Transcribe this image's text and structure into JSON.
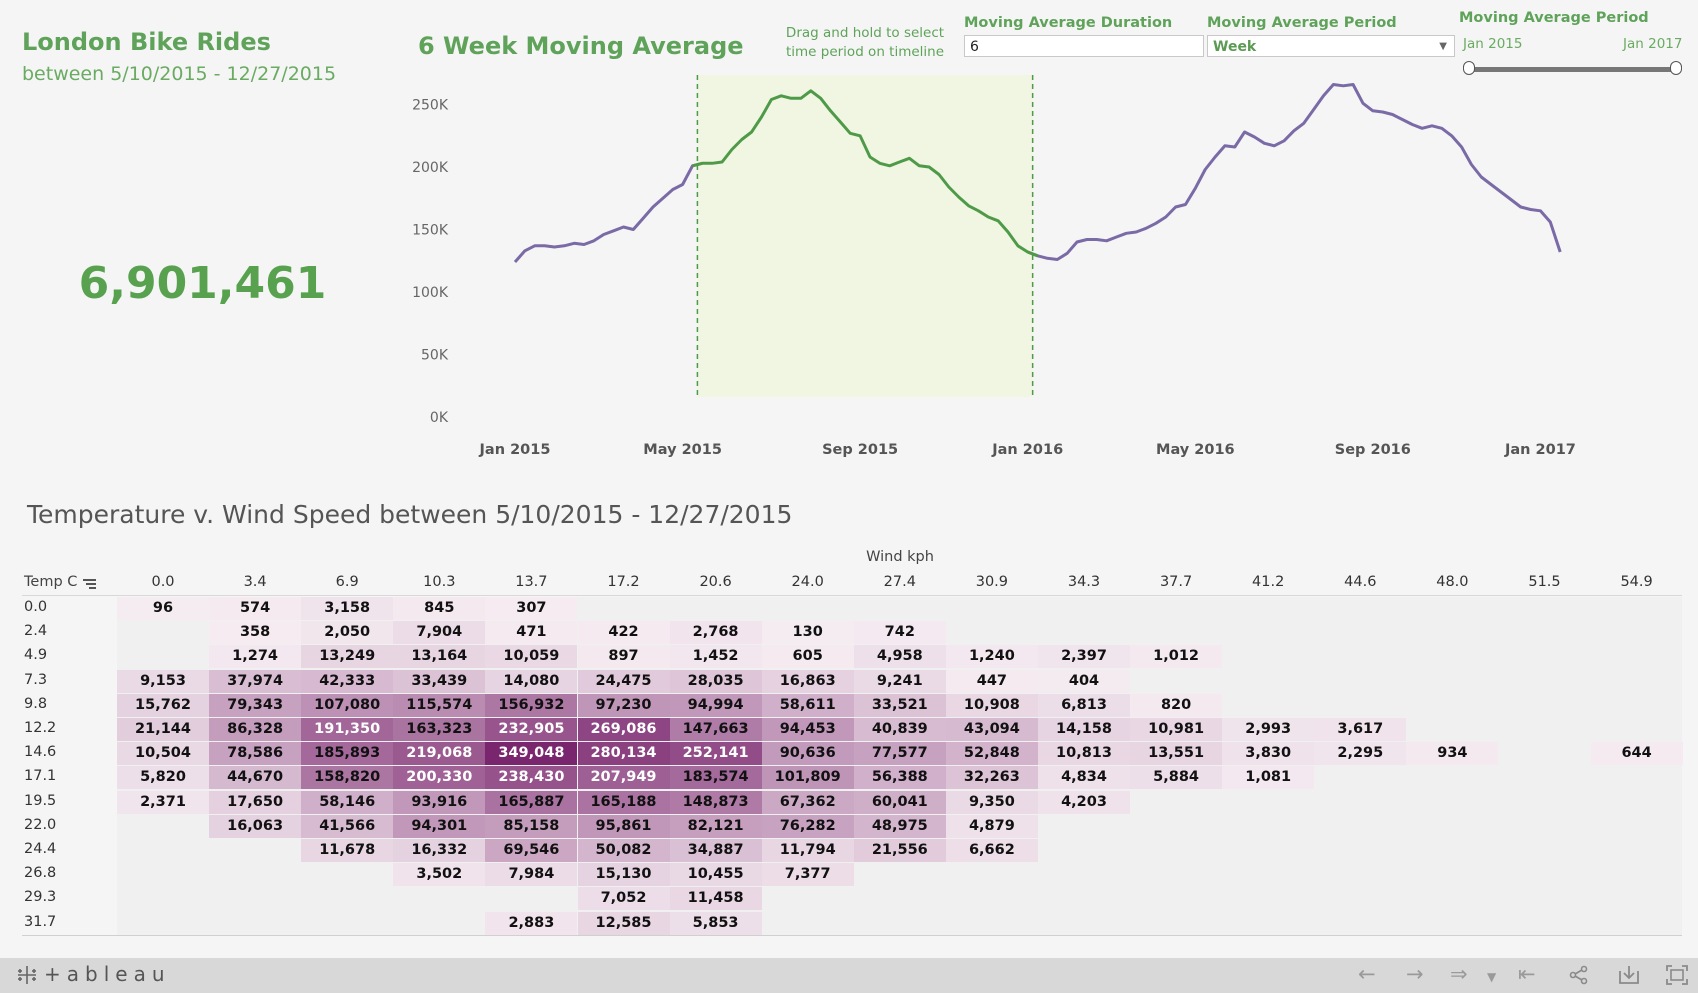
{
  "header": {
    "title": "London Bike Rides",
    "subtitle": "between 5/10/2015 - 12/27/2015",
    "kpi_total": "6,901,461"
  },
  "line_chart": {
    "title": "6 Week Moving Average",
    "hint": "Drag and hold to select time period on timeline"
  },
  "controls": {
    "duration_label": "Moving Average Duration",
    "duration_value": "6",
    "period_label": "Moving Average Period",
    "period_value": "Week",
    "slider_label": "Moving Average Period",
    "slider_min": "Jan 2015",
    "slider_max": "Jan 2017"
  },
  "heatmap": {
    "title": "Temperature v. Wind Speed between 5/10/2015 - 12/27/2015",
    "x_title": "Wind kph",
    "y_title": "Temp C",
    "columns": [
      "0.0",
      "3.4",
      "6.9",
      "10.3",
      "13.7",
      "17.2",
      "20.6",
      "24.0",
      "27.4",
      "30.9",
      "34.3",
      "37.7",
      "41.2",
      "44.6",
      "48.0",
      "51.5",
      "54.9"
    ],
    "rows": [
      "0.0",
      "2.4",
      "4.9",
      "7.3",
      "9.8",
      "12.2",
      "14.6",
      "17.1",
      "19.5",
      "22.0",
      "24.4",
      "26.8",
      "29.3",
      "31.7"
    ],
    "values": [
      [
        96,
        574,
        3158,
        845,
        307,
        null,
        null,
        null,
        null,
        null,
        null,
        null,
        null,
        null,
        null,
        null,
        null
      ],
      [
        null,
        358,
        2050,
        7904,
        471,
        422,
        2768,
        130,
        742,
        null,
        null,
        null,
        null,
        null,
        null,
        null,
        null
      ],
      [
        null,
        1274,
        13249,
        13164,
        10059,
        897,
        1452,
        605,
        4958,
        1240,
        2397,
        1012,
        null,
        null,
        null,
        null,
        null
      ],
      [
        9153,
        37974,
        42333,
        33439,
        14080,
        24475,
        28035,
        16863,
        9241,
        447,
        404,
        null,
        null,
        null,
        null,
        null,
        null
      ],
      [
        15762,
        79343,
        107080,
        115574,
        156932,
        97230,
        94994,
        58611,
        33521,
        10908,
        6813,
        820,
        null,
        null,
        null,
        null,
        null
      ],
      [
        21144,
        86328,
        191350,
        163323,
        232905,
        269086,
        147663,
        94453,
        40839,
        43094,
        14158,
        10981,
        2993,
        3617,
        null,
        null,
        null
      ],
      [
        10504,
        78586,
        185893,
        219068,
        349048,
        280134,
        252141,
        90636,
        77577,
        52848,
        10813,
        13551,
        3830,
        2295,
        934,
        null,
        644
      ],
      [
        5820,
        44670,
        158820,
        200330,
        238430,
        207949,
        183574,
        101809,
        56388,
        32263,
        4834,
        5884,
        1081,
        null,
        null,
        null,
        null
      ],
      [
        2371,
        17650,
        58146,
        93916,
        165887,
        165188,
        148873,
        67362,
        60041,
        9350,
        4203,
        null,
        null,
        null,
        null,
        null,
        null
      ],
      [
        null,
        16063,
        41566,
        94301,
        85158,
        95861,
        82121,
        76282,
        48975,
        4879,
        null,
        null,
        null,
        null,
        null,
        null,
        null
      ],
      [
        null,
        null,
        11678,
        16332,
        69546,
        50082,
        34887,
        11794,
        21556,
        6662,
        null,
        null,
        null,
        null,
        null,
        null,
        null
      ],
      [
        null,
        null,
        null,
        3502,
        7984,
        15130,
        10455,
        7377,
        null,
        null,
        null,
        null,
        null,
        null,
        null,
        null,
        null
      ],
      [
        null,
        null,
        null,
        null,
        null,
        7052,
        11458,
        null,
        null,
        null,
        null,
        null,
        null,
        null,
        null,
        null,
        null
      ],
      [
        null,
        null,
        null,
        null,
        2883,
        12585,
        5853,
        null,
        null,
        null,
        null,
        null,
        null,
        null,
        null,
        null,
        null
      ]
    ]
  },
  "chart_data": {
    "type": "line",
    "title": "6 Week Moving Average",
    "ylim": [
      0,
      270000
    ],
    "y_ticks": [
      0,
      50000,
      100000,
      150000,
      200000,
      250000
    ],
    "y_tick_labels": [
      "0K",
      "50K",
      "100K",
      "150K",
      "200K",
      "250K"
    ],
    "x_tick_labels": [
      "Jan 2015",
      "May 2015",
      "Sep 2015",
      "Jan 2016",
      "May 2016",
      "Sep 2016",
      "Jan 2017"
    ],
    "x_tick_weeks": [
      0,
      17,
      35,
      52,
      69,
      87,
      104
    ],
    "highlight_weeks": [
      18.5,
      52.5
    ],
    "colors": {
      "series": "#7a6aa6",
      "highlight_series": "#4f9a48",
      "highlight_fill": "#f0f6e2",
      "highlight_line": "#4f9a48"
    },
    "series": [
      {
        "start_week": 0,
        "values": [
          124000,
          133000,
          137000,
          137000,
          136000,
          137000,
          139000,
          138000,
          141000,
          146000,
          149000,
          152000,
          150000,
          159000,
          168000,
          175000,
          182000,
          186000,
          201000,
          203000,
          203000,
          204000,
          214000,
          222000,
          228000,
          240000,
          254000,
          257000,
          255000,
          255000,
          261000,
          255000,
          245000,
          236000,
          227000,
          225000,
          208000,
          203000,
          201000,
          204000,
          207000,
          201000,
          200000,
          194000,
          184000,
          176000,
          169000,
          165000,
          160000,
          157000,
          148000,
          137000,
          132000,
          129000,
          127000,
          126000,
          131000,
          140000,
          142000,
          142000,
          141000,
          144000,
          147000,
          148000,
          151000,
          155000,
          160000,
          168000,
          170000,
          183000,
          198000,
          208000,
          217000,
          216000,
          228000,
          224000,
          219000,
          217000,
          221000,
          229000,
          235000,
          246000,
          257000,
          266000,
          265000,
          266000,
          251000,
          245000,
          244000,
          242000,
          238000,
          234000,
          231000,
          233000,
          231000,
          225000,
          216000,
          202000,
          192000,
          186000,
          180000,
          174000,
          168000,
          166000,
          165000,
          156000,
          132000
        ]
      }
    ]
  }
}
